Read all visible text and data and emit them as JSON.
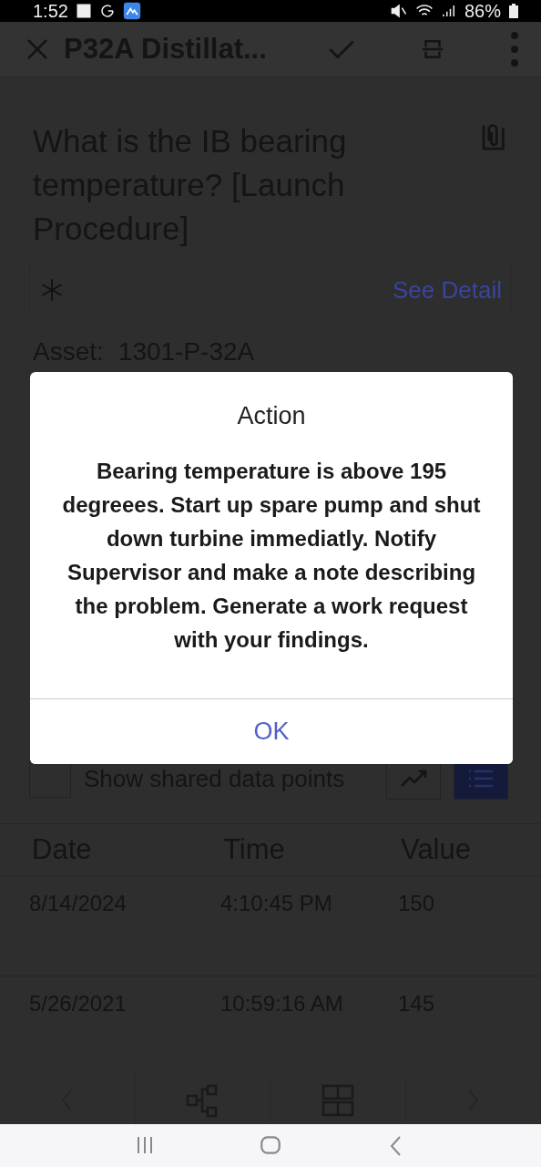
{
  "status_bar": {
    "time": "1:52",
    "battery": "86%"
  },
  "app_bar": {
    "title": "P32A Distillat..."
  },
  "question": {
    "text": "What is the IB bearing temperature? [Launch Procedure]",
    "link": "See Detail",
    "starred": true
  },
  "asset": {
    "label": "Asset:",
    "value": "1301-P-32A"
  },
  "shared_points": {
    "label": "Show shared data points",
    "checked": false
  },
  "view_toggle": [
    {
      "kind": "chart",
      "selected": false
    },
    {
      "kind": "list",
      "selected": true
    }
  ],
  "table": {
    "columns": [
      "Date",
      "Time",
      "Value"
    ],
    "rows": [
      {
        "cells": [
          "8/14/2024",
          "4:10:45 PM",
          "150"
        ]
      },
      {
        "cells": [
          "5/26/2021",
          "10:59:16 AM",
          "145"
        ]
      }
    ]
  },
  "dialog": {
    "title": "Action",
    "message": "Bearing temperature is above 195 degreees. Start up spare pump and shut down turbine immediatly. Notify Supervisor and make a note describing the problem. Generate a work request with your findings.",
    "button": "OK"
  }
}
